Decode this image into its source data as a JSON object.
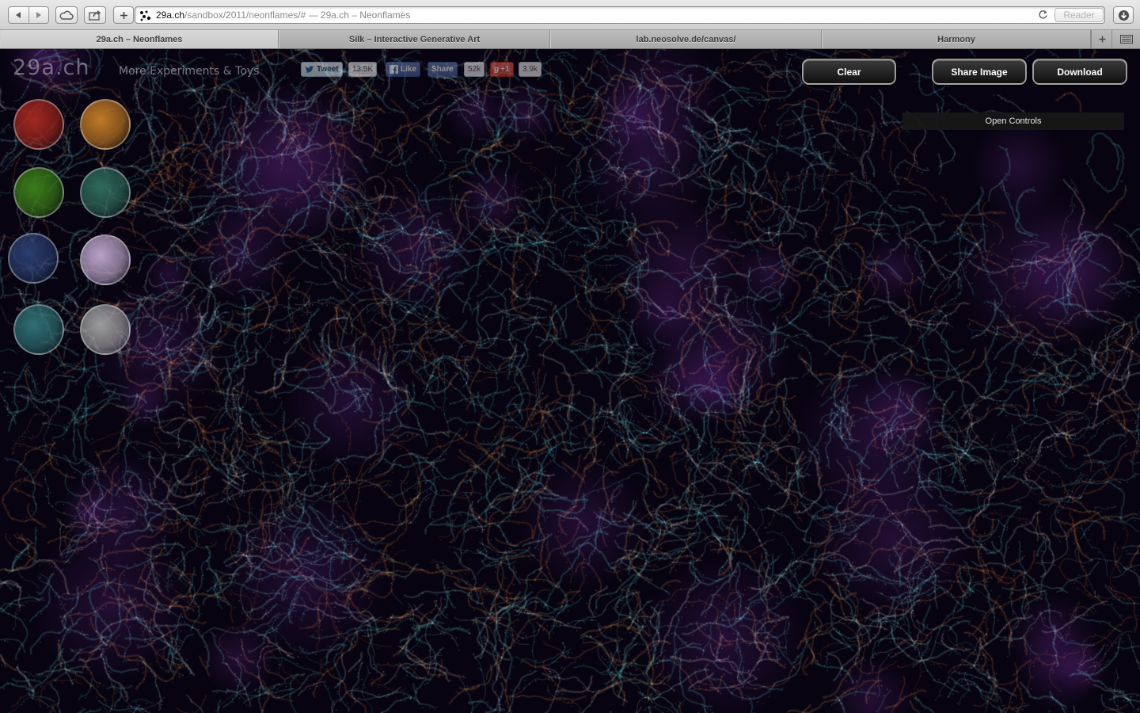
{
  "browser": {
    "url_host": "29a.ch",
    "url_rest": "/sandbox/2011/neonflames/# — 29a.ch – Neonflames",
    "reader_label": "Reader",
    "tabs": [
      {
        "label": "29a.ch – Neonflames",
        "active": true
      },
      {
        "label": "Silk – Interactive Generative Art",
        "active": false
      },
      {
        "label": "lab.neosolve.de/canvas/",
        "active": false
      },
      {
        "label": "Harmony",
        "active": false
      }
    ],
    "icons": [
      "back-icon",
      "forward-icon",
      "icloud-icon",
      "share-icon",
      "add-bookmark-icon",
      "reload-icon",
      "downloads-icon",
      "new-tab-icon",
      "tab-view-icon"
    ]
  },
  "page": {
    "logo": "29a.ch",
    "tagline": "More Experiments & Toys",
    "social": {
      "tweet_label": "Tweet",
      "tweet_count": "13.5K",
      "like_label": "Like",
      "share_label": "Share",
      "like_count": "52k",
      "gplus_label": "+1",
      "gplus_count": "3.9k"
    },
    "buttons": {
      "clear": "Clear",
      "share_image": "Share Image",
      "download": "Download"
    },
    "open_controls": "Open Controls",
    "palette": [
      {
        "name": "red",
        "color": "#a3281f"
      },
      {
        "name": "orange",
        "color": "#c07a25"
      },
      {
        "name": "green",
        "color": "#3b7d1a"
      },
      {
        "name": "teal",
        "color": "#2e6a5a"
      },
      {
        "name": "blue",
        "color": "#2a3d6e"
      },
      {
        "name": "lilac",
        "color": "#b9a3c8"
      },
      {
        "name": "cyan",
        "color": "#2f6f73"
      },
      {
        "name": "white",
        "color": "#9d9d9d"
      }
    ],
    "colors": {
      "background": "#070310",
      "neon_cyan": "#5fe3d0",
      "neon_orange": "#e8a04a",
      "neon_purple": "#8a3fb0"
    }
  }
}
